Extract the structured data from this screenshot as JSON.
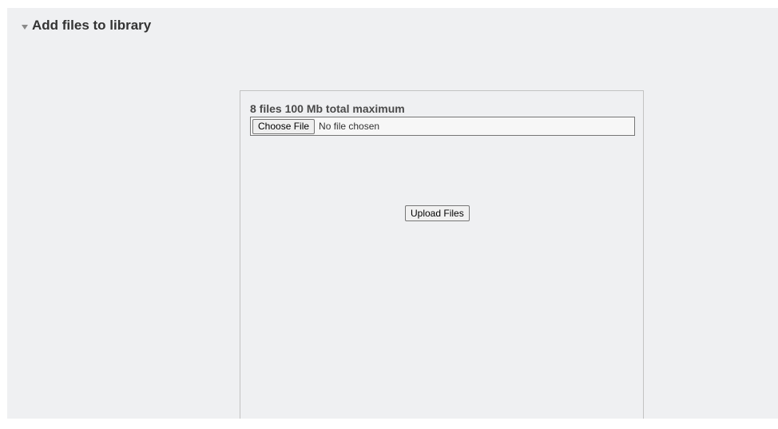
{
  "panel": {
    "title": "Add files to library",
    "toggle_icon": "caret-down-icon"
  },
  "upload": {
    "limit_text": "8 files 100 Mb total maximum",
    "choose_label": "Choose File",
    "file_status": "No file chosen",
    "upload_label": "Upload Files"
  }
}
